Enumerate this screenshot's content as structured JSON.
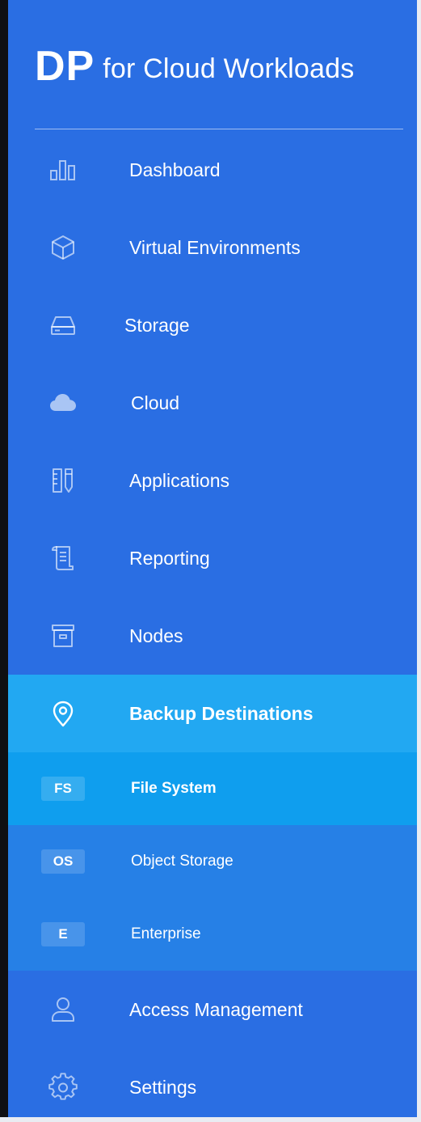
{
  "brand": {
    "logo": "DP",
    "subtitle": "for Cloud Workloads"
  },
  "menu": [
    {
      "label": "Dashboard",
      "icon": "bar-chart-icon"
    },
    {
      "label": "Virtual Environments",
      "icon": "cube-icon"
    },
    {
      "label": "Storage",
      "icon": "hard-drive-icon"
    },
    {
      "label": "Cloud",
      "icon": "cloud-icon"
    },
    {
      "label": "Applications",
      "icon": "applications-icon"
    },
    {
      "label": "Reporting",
      "icon": "scroll-icon"
    },
    {
      "label": "Nodes",
      "icon": "archive-box-icon"
    },
    {
      "label": "Backup Destinations",
      "icon": "location-pin-icon",
      "active": true
    },
    {
      "label": "Access Management",
      "icon": "user-icon"
    },
    {
      "label": "Settings",
      "icon": "gear-icon"
    }
  ],
  "submenu": [
    {
      "badge": "FS",
      "label": "File System",
      "active": true
    },
    {
      "badge": "OS",
      "label": "Object Storage"
    },
    {
      "badge": "E",
      "label": "Enterprise"
    }
  ],
  "colors": {
    "sidebar": "#2a6ee3",
    "active_item": "#22a8f2",
    "submenu_bg": "#2680e6",
    "active_sub": "#0f9eee",
    "text": "#ffffff"
  }
}
